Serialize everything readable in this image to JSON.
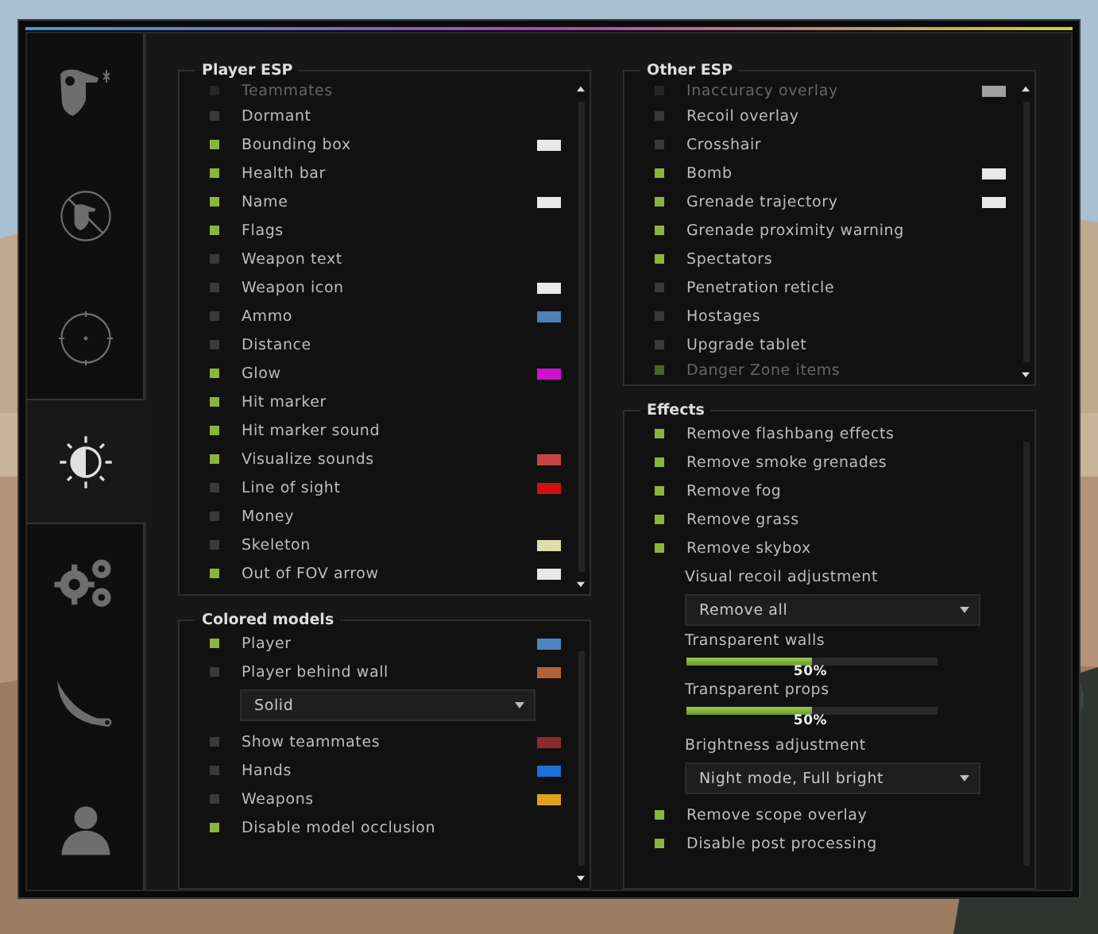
{
  "sidebar": {
    "tabs": [
      {
        "kind": "mask",
        "selected": false
      },
      {
        "kind": "no-mask",
        "selected": false
      },
      {
        "kind": "crosshair",
        "selected": false
      },
      {
        "kind": "brightness",
        "selected": true
      },
      {
        "kind": "gears",
        "selected": false
      },
      {
        "kind": "blade",
        "selected": false
      },
      {
        "kind": "user",
        "selected": false
      }
    ]
  },
  "columns": [
    [
      {
        "title": "Player ESP",
        "scroll_up": true,
        "items": [
          {
            "kind": "checkbox",
            "label": "Teammates",
            "checked": false,
            "faded": true
          },
          {
            "kind": "checkbox",
            "label": "Dormant",
            "checked": false
          },
          {
            "kind": "checkbox",
            "label": "Bounding box",
            "checked": true,
            "color": "#e8e8e8"
          },
          {
            "kind": "checkbox",
            "label": "Health bar",
            "checked": true
          },
          {
            "kind": "checkbox",
            "label": "Name",
            "checked": true,
            "color": "#e8e8e8"
          },
          {
            "kind": "checkbox",
            "label": "Flags",
            "checked": true
          },
          {
            "kind": "checkbox",
            "label": "Weapon text",
            "checked": false
          },
          {
            "kind": "checkbox",
            "label": "Weapon icon",
            "checked": false,
            "color": "#e8e8e8"
          },
          {
            "kind": "checkbox",
            "label": "Ammo",
            "checked": false,
            "color": "#4f7fb3"
          },
          {
            "kind": "checkbox",
            "label": "Distance",
            "checked": false
          },
          {
            "kind": "checkbox",
            "label": "Glow",
            "checked": true,
            "color": "#d010d0"
          },
          {
            "kind": "checkbox",
            "label": "Hit marker",
            "checked": true
          },
          {
            "kind": "checkbox",
            "label": "Hit marker sound",
            "checked": true
          },
          {
            "kind": "checkbox",
            "label": "Visualize sounds",
            "checked": true,
            "color": "#c84444"
          },
          {
            "kind": "checkbox",
            "label": "Line of sight",
            "checked": false,
            "color": "#d01010"
          },
          {
            "kind": "checkbox",
            "label": "Money",
            "checked": false
          },
          {
            "kind": "checkbox",
            "label": "Skeleton",
            "checked": false,
            "color": "#dcdcae"
          },
          {
            "kind": "checkbox",
            "label": "Out of FOV arrow",
            "checked": true,
            "color": "#e8e8e8"
          }
        ]
      },
      {
        "title": "Colored models",
        "scroll_up": false,
        "items": [
          {
            "kind": "checkbox",
            "label": "Player",
            "checked": true,
            "color": "#4f84c0"
          },
          {
            "kind": "checkbox",
            "label": "Player behind wall",
            "checked": false,
            "color": "#b0643a"
          },
          {
            "kind": "dropdown",
            "value": "Solid"
          },
          {
            "kind": "checkbox",
            "label": "Show teammates",
            "checked": false,
            "color": "#8a2a2a"
          },
          {
            "kind": "checkbox",
            "label": "Hands",
            "checked": false,
            "color": "#1e6fd8"
          },
          {
            "kind": "checkbox",
            "label": "Weapons",
            "checked": false,
            "color": "#e0a020"
          },
          {
            "kind": "checkbox",
            "label": "Disable model occlusion",
            "checked": true
          }
        ]
      }
    ],
    [
      {
        "title": "Other ESP",
        "scroll_up": true,
        "items": [
          {
            "kind": "checkbox",
            "label": "Inaccuracy overlay",
            "checked": false,
            "color": "#a0a0a0",
            "faded": true
          },
          {
            "kind": "checkbox",
            "label": "Recoil overlay",
            "checked": false
          },
          {
            "kind": "checkbox",
            "label": "Crosshair",
            "checked": false
          },
          {
            "kind": "checkbox",
            "label": "Bomb",
            "checked": true,
            "color": "#e8e8e8"
          },
          {
            "kind": "checkbox",
            "label": "Grenade trajectory",
            "checked": true,
            "color": "#e8e8e8"
          },
          {
            "kind": "checkbox",
            "label": "Grenade proximity warning",
            "checked": true
          },
          {
            "kind": "checkbox",
            "label": "Spectators",
            "checked": true
          },
          {
            "kind": "checkbox",
            "label": "Penetration reticle",
            "checked": false
          },
          {
            "kind": "checkbox",
            "label": "Hostages",
            "checked": false
          },
          {
            "kind": "checkbox",
            "label": "Upgrade tablet",
            "checked": false
          },
          {
            "kind": "checkbox",
            "label": "Danger Zone items",
            "checked": true,
            "faded": true
          }
        ]
      },
      {
        "title": "Effects",
        "scroll_up": false,
        "items": [
          {
            "kind": "checkbox",
            "label": "Remove flashbang effects",
            "checked": true
          },
          {
            "kind": "checkbox",
            "label": "Remove smoke grenades",
            "checked": true
          },
          {
            "kind": "checkbox",
            "label": "Remove fog",
            "checked": true
          },
          {
            "kind": "checkbox",
            "label": "Remove grass",
            "checked": true
          },
          {
            "kind": "checkbox",
            "label": "Remove skybox",
            "checked": true
          },
          {
            "kind": "label",
            "label": "Visual recoil adjustment"
          },
          {
            "kind": "dropdown",
            "value": "Remove all"
          },
          {
            "kind": "slider",
            "label": "Transparent walls",
            "level": 0.5,
            "reading": "50%"
          },
          {
            "kind": "slider",
            "label": "Transparent props",
            "level": 0.5,
            "reading": "50%"
          },
          {
            "kind": "label",
            "label": "Brightness adjustment"
          },
          {
            "kind": "dropdown",
            "value": "Night mode, Full bright"
          },
          {
            "kind": "checkbox",
            "label": "Remove scope overlay",
            "checked": true
          },
          {
            "kind": "checkbox",
            "label": "Disable post processing",
            "checked": true
          }
        ]
      }
    ]
  ]
}
